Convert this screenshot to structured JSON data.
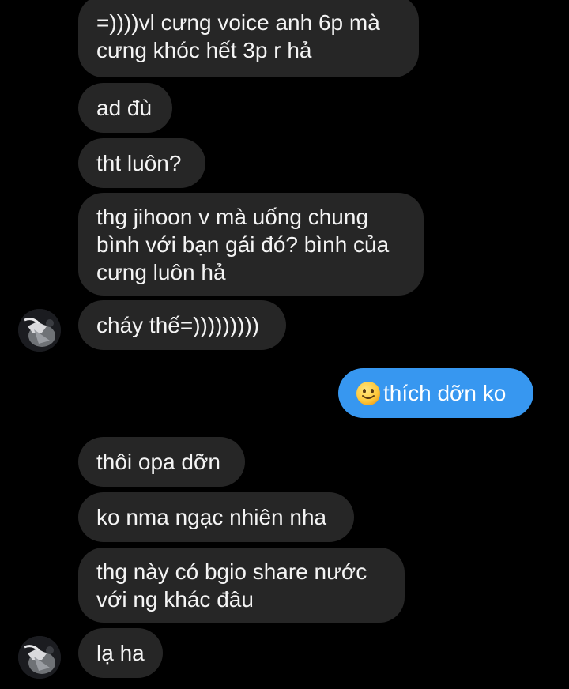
{
  "messages": [
    {
      "text": "=))))vl cưng voice anh 6p mà\ncưng khóc hết 3p r hả",
      "side": "in"
    },
    {
      "text": "ad đù",
      "side": "in"
    },
    {
      "text": "tht luôn?",
      "side": "in"
    },
    {
      "text": "thg jihoon v mà uống chung\nbình với bạn gái đó? bình của\ncưng luôn hả",
      "side": "in"
    },
    {
      "text": "cháy thế=)))))))))",
      "side": "in",
      "avatar": true
    },
    {
      "text": "thích dỡn ko",
      "side": "out",
      "emoji": "slightly-smiling-face-icon"
    },
    {
      "text": "thôi opa dỡn",
      "side": "in"
    },
    {
      "text": "ko nma ngạc nhiên nha",
      "side": "in"
    },
    {
      "text": "thg này có bgio share nước\nvới ng khác đâu",
      "side": "in"
    },
    {
      "text": "lạ ha",
      "side": "in",
      "avatar": true
    }
  ],
  "colors": {
    "background": "#000000",
    "incoming_bubble": "#262626",
    "outgoing_bubble": "#3797f0",
    "text": "#f4f4f4"
  }
}
